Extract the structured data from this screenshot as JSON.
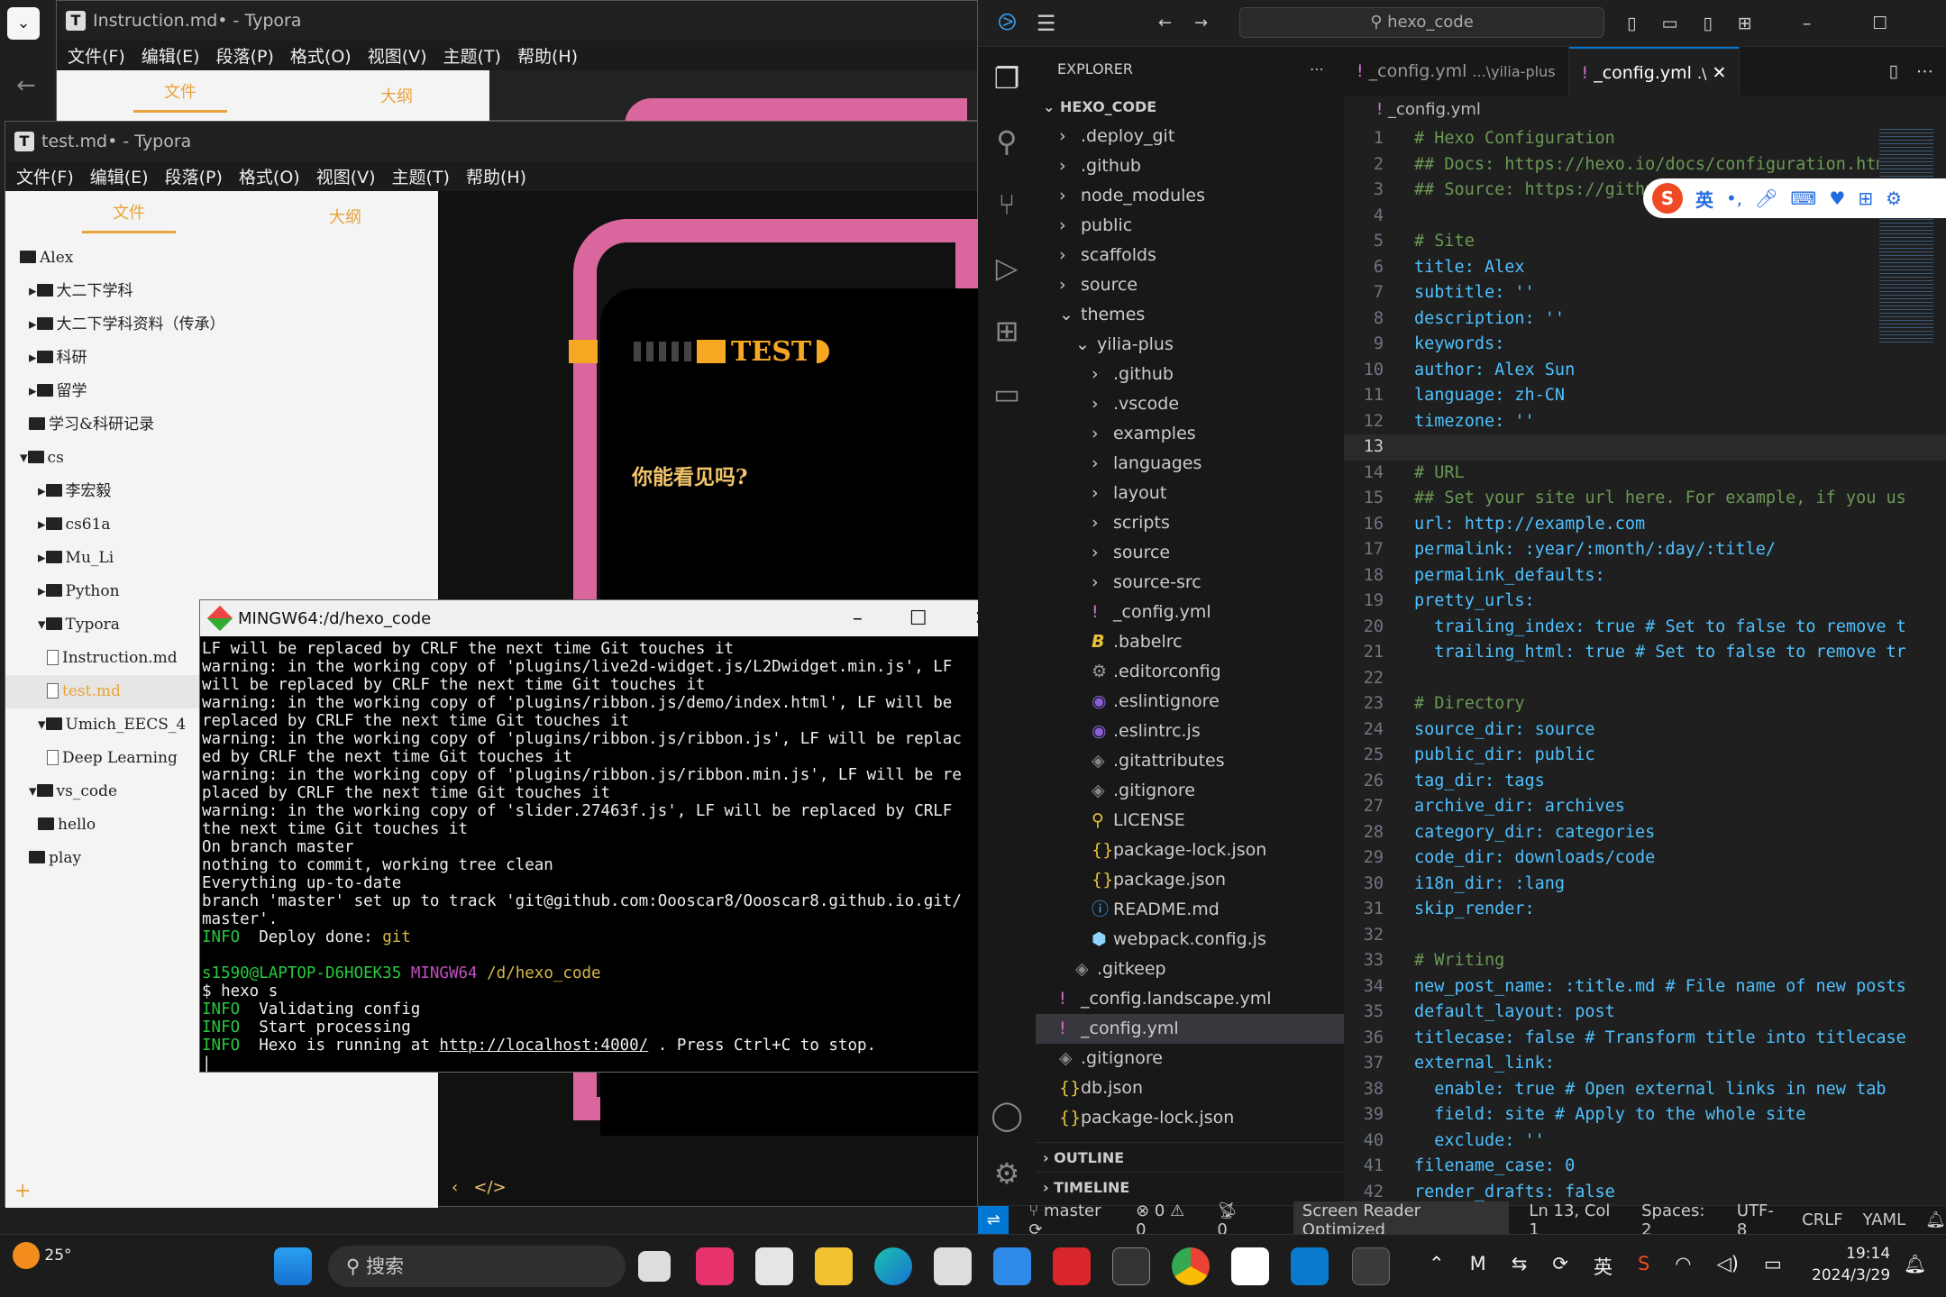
{
  "typora_back": {
    "title": "Instruction.md• - Typora",
    "menu": [
      "文件(F)",
      "编辑(E)",
      "段落(P)",
      "格式(O)",
      "视图(V)",
      "主题(T)",
      "帮助(H)"
    ],
    "tab_files": "文件",
    "tab_outline": "大纲"
  },
  "typora": {
    "title": "test.md• - Typora",
    "menu": [
      "文件(F)",
      "编辑(E)",
      "段落(P)",
      "格式(O)",
      "视图(V)",
      "主题(T)",
      "帮助(H)"
    ],
    "tab_files": "文件",
    "tab_outline": "大纲",
    "tree": [
      "Alex",
      "大二下学科",
      "大二下学科资料（传承）",
      "科研",
      "留学",
      "学习&科研记录",
      "cs",
      "李宏毅",
      "cs61a",
      "Mu_Li",
      "Python",
      "Typora",
      "Instruction.md",
      "test.md",
      "Umich_EECS_4",
      "Deep Learning",
      "vs_code",
      "hello",
      "play"
    ],
    "art_test": "TEST",
    "art_question": "你能看见吗?"
  },
  "terminal": {
    "title": "MINGW64:/d/hexo_code",
    "lines": [
      "LF will be replaced by CRLF the next time Git touches it",
      "warning: in the working copy of 'plugins/live2d-widget.js/L2Dwidget.min.js', LF",
      "will be replaced by CRLF the next time Git touches it",
      "warning: in the working copy of 'plugins/ribbon.js/demo/index.html', LF will be",
      "replaced by CRLF the next time Git touches it",
      "warning: in the working copy of 'plugins/ribbon.js/ribbon.js', LF will be replac",
      "ed by CRLF the next time Git touches it",
      "warning: in the working copy of 'plugins/ribbon.js/ribbon.min.js', LF will be re",
      "placed by CRLF the next time Git touches it",
      "warning: in the working copy of 'slider.27463f.js', LF will be replaced by CRLF",
      "the next time Git touches it",
      "On branch master",
      "nothing to commit, working tree clean",
      "Everything up-to-date",
      "branch 'master' set up to track 'git@github.com:Oooscar8/Oooscar8.github.io.git/",
      "master'."
    ],
    "info_deploy": "INFO",
    "deploy_text": "  Deploy done: ",
    "deploy_git": "git",
    "prompt_user": "s1590@LAPTOP-D6HOEK35",
    "prompt_env": "MINGW64",
    "prompt_path": "/d/hexo_code",
    "cmd": "$ hexo s",
    "info1": "  Validating config",
    "info2": "  Start processing",
    "info3_pre": "  Hexo is running at ",
    "info3_url": "http://localhost:4000/",
    "info3_post": " . Press Ctrl+C to stop."
  },
  "vscode": {
    "search": "hexo_code",
    "explorer_title": "EXPLORER",
    "root": "HEXO_CODE",
    "tree": [
      ".deploy_git",
      ".github",
      "node_modules",
      "public",
      "scaffolds",
      "source",
      "themes",
      "yilia-plus",
      ".github",
      ".vscode",
      "examples",
      "languages",
      "layout",
      "scripts",
      "source",
      "source-src",
      "_config.yml",
      ".babelrc",
      ".editorconfig",
      ".eslintignore",
      ".eslintrc.js",
      ".gitattributes",
      ".gitignore",
      "LICENSE",
      "package-lock.json",
      "package.json",
      "README.md",
      "webpack.config.js",
      ".gitkeep",
      "_config.landscape.yml",
      "_config.yml",
      ".gitignore",
      "db.json",
      "package-lock.json"
    ],
    "outline": "OUTLINE",
    "timeline": "TIMELINE",
    "tab1": "_config.yml",
    "tab1_path": "...\\yilia-plus",
    "tab2": "_config.yml",
    "tab2_path": ".\\",
    "breadcrumb": "_config.yml",
    "status": {
      "branch": "master",
      "errors": "0",
      "warnings": "0",
      "ports": "0",
      "reader": "Screen Reader Optimized",
      "position": "Ln 13, Col 1",
      "spaces": "Spaces: 2",
      "encoding": "UTF-8",
      "eol": "CRLF",
      "lang": "YAML"
    }
  },
  "code_lines": [
    "# Hexo Configuration",
    "## Docs: https://hexo.io/docs/configuration.html",
    "## Source: https://github.com/hexojs/hexo/",
    "",
    "# Site",
    "title: Alex",
    "subtitle: ''",
    "description: ''",
    "keywords:",
    "author: Alex Sun",
    "language: zh-CN",
    "timezone: ''",
    "",
    "# URL",
    "## Set your site url here. For example, if you us",
    "url: http://example.com",
    "permalink: :year/:month/:day/:title/",
    "permalink_defaults:",
    "pretty_urls:",
    "  trailing_index: true # Set to false to remove t",
    "  trailing_html: true # Set to false to remove tr",
    "",
    "# Directory",
    "source_dir: source",
    "public_dir: public",
    "tag_dir: tags",
    "archive_dir: archives",
    "category_dir: categories",
    "code_dir: downloads/code",
    "i18n_dir: :lang",
    "skip_render:",
    "",
    "# Writing",
    "new_post_name: :title.md # File name of new posts",
    "default_layout: post",
    "titlecase: false # Transform title into titlecase",
    "external_link:",
    "  enable: true # Open external links in new tab",
    "  field: site # Apply to the whole site",
    "  exclude: ''",
    "filename_case: 0",
    "render_drafts: false"
  ],
  "ime_label": "英",
  "taskbar": {
    "temp": "25°",
    "search": "搜索",
    "ime": "英",
    "time": "19:14",
    "date": "2024/3/29"
  }
}
